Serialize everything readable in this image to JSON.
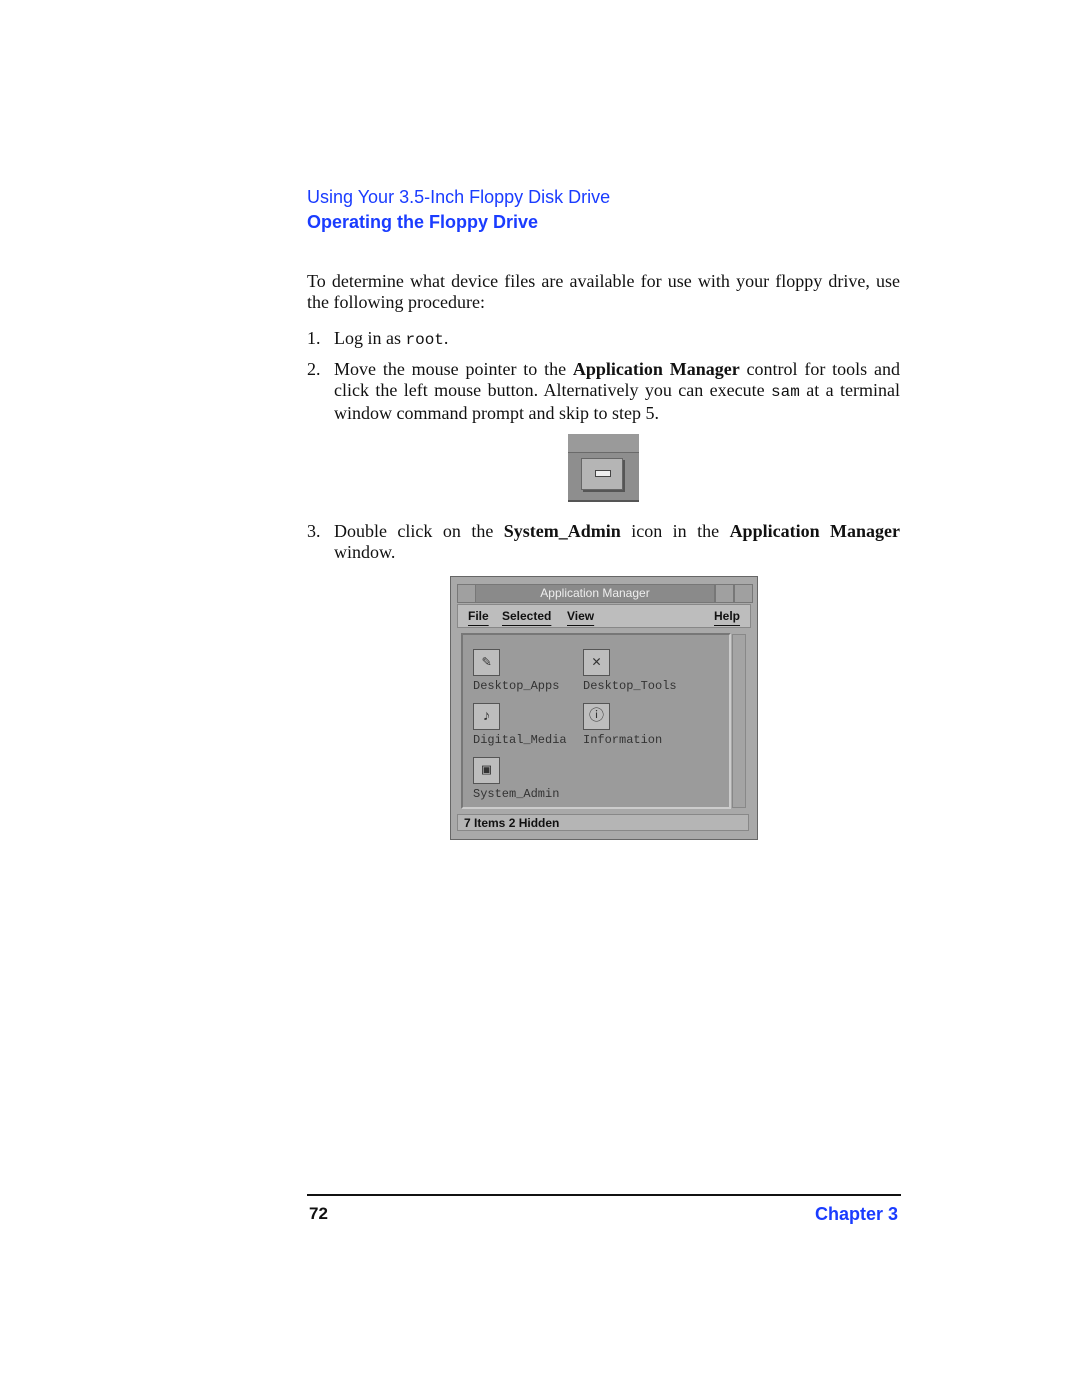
{
  "header": {
    "section": "Using Your 3.5-Inch Floppy Disk Drive",
    "title": "Operating the Floppy Drive"
  },
  "intro": "To determine what device files are available for use with your floppy drive, use the following procedure:",
  "steps": [
    {
      "num": "1.",
      "pre": "Log in as ",
      "code": "root",
      "post": "."
    },
    {
      "num": "2.",
      "pre": "Move the mouse pointer to the ",
      "bold": "Application Manager",
      "mid": " control for tools and click the left mouse button. Alternatively you can execute ",
      "code": "sam",
      "post": " at a terminal window command prompt and skip to step 5."
    },
    {
      "num": "3.",
      "pre": "Double click on the ",
      "bold": "System_Admin",
      "mid": " icon in the ",
      "bold2": "Application Manager",
      "post": " window."
    }
  ],
  "window": {
    "title": "Application Manager",
    "menu": [
      "File",
      "Selected",
      "View",
      "Help"
    ],
    "items": [
      {
        "label": "Desktop_Apps",
        "icon": "calculator-pen-icon"
      },
      {
        "label": "Desktop_Tools",
        "icon": "tools-icon"
      },
      {
        "label": "Digital_Media",
        "icon": "microphone-icon"
      },
      {
        "label": "Information",
        "icon": "info-icon"
      },
      {
        "label": "System_Admin",
        "icon": "computer-icon"
      }
    ],
    "status": "7 Items 2 Hidden"
  },
  "footer": {
    "page": "72",
    "chapter": "Chapter 3"
  }
}
